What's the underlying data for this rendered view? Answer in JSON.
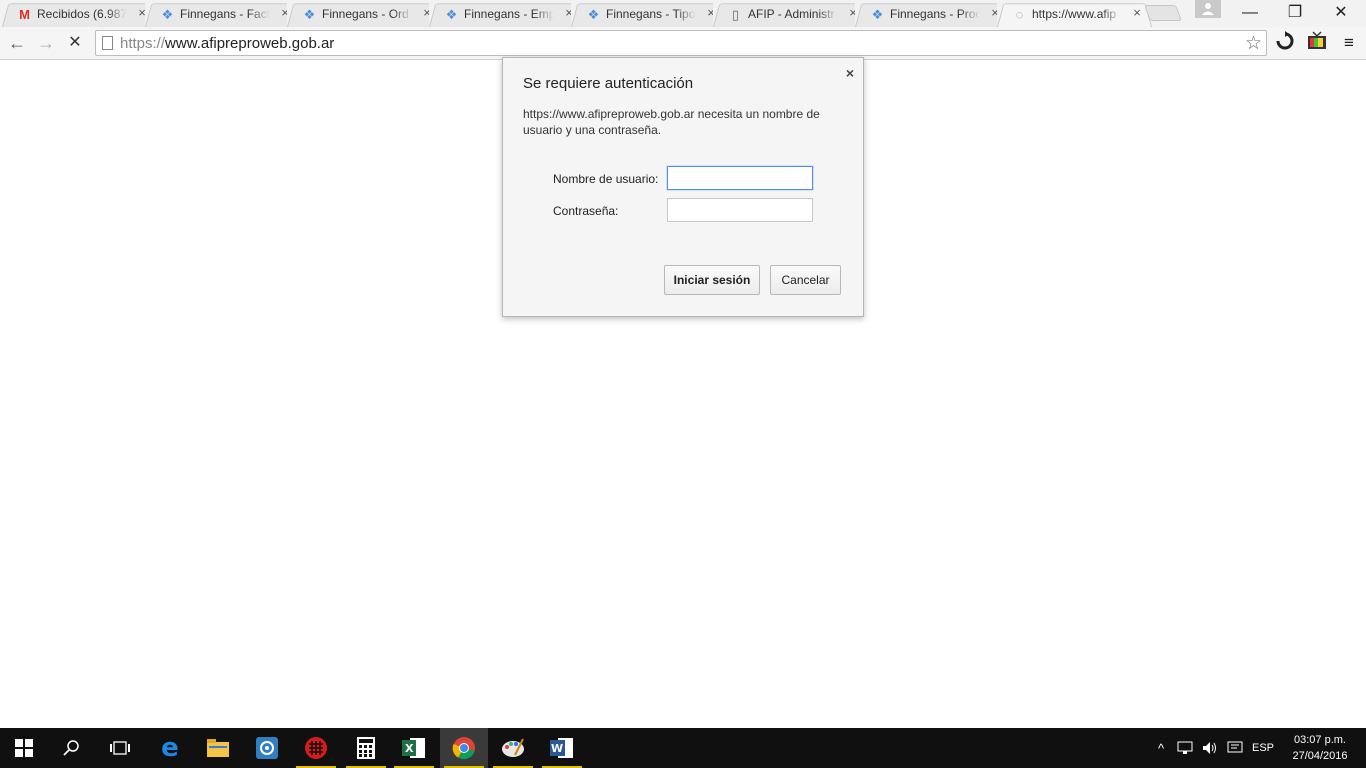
{
  "browser": {
    "tabs": [
      {
        "title": "Recibidos (6.987",
        "favicon": "gmail-icon",
        "active": false
      },
      {
        "title": "Finnegans - Fact",
        "favicon": "finnegans-icon",
        "active": false
      },
      {
        "title": "Finnegans - Ord",
        "favicon": "finnegans-icon",
        "active": false
      },
      {
        "title": "Finnegans - Emp",
        "favicon": "finnegans-icon",
        "active": false
      },
      {
        "title": "Finnegans - Tipo",
        "favicon": "finnegans-icon",
        "active": false
      },
      {
        "title": "AFIP - Administr",
        "favicon": "document-icon",
        "active": false
      },
      {
        "title": "Finnegans - Proc",
        "favicon": "finnegans-icon",
        "active": false
      },
      {
        "title": "https://www.afip",
        "favicon": "loading-icon",
        "active": true
      }
    ],
    "tab_close_glyph": "×",
    "window_controls": {
      "minimize": "—",
      "restore": "❐",
      "close": "✕"
    },
    "address_bar": {
      "scheme": "https://",
      "host": "www.afipreproweb.gob.ar"
    },
    "nav": {
      "back": "←",
      "forward": "→",
      "stop": "✕"
    },
    "bookmark_star": "☆",
    "menu_glyph": "≡"
  },
  "auth_dialog": {
    "title": "Se requiere autenticación",
    "close_glyph": "×",
    "message": "https://www.afipreproweb.gob.ar necesita un nombre de usuario y una contraseña.",
    "username_label": "Nombre de usuario:",
    "username_value": "",
    "password_label": "Contraseña:",
    "password_value": "",
    "login_button": "Iniciar sesión",
    "cancel_button": "Cancelar"
  },
  "taskbar": {
    "language": "ESP",
    "time": "03:07 p.m.",
    "date": "27/04/2016"
  },
  "colors": {
    "focus_border": "#4d90fe",
    "taskbar_bg": "#101010",
    "running_indicator": "#e0c000"
  }
}
